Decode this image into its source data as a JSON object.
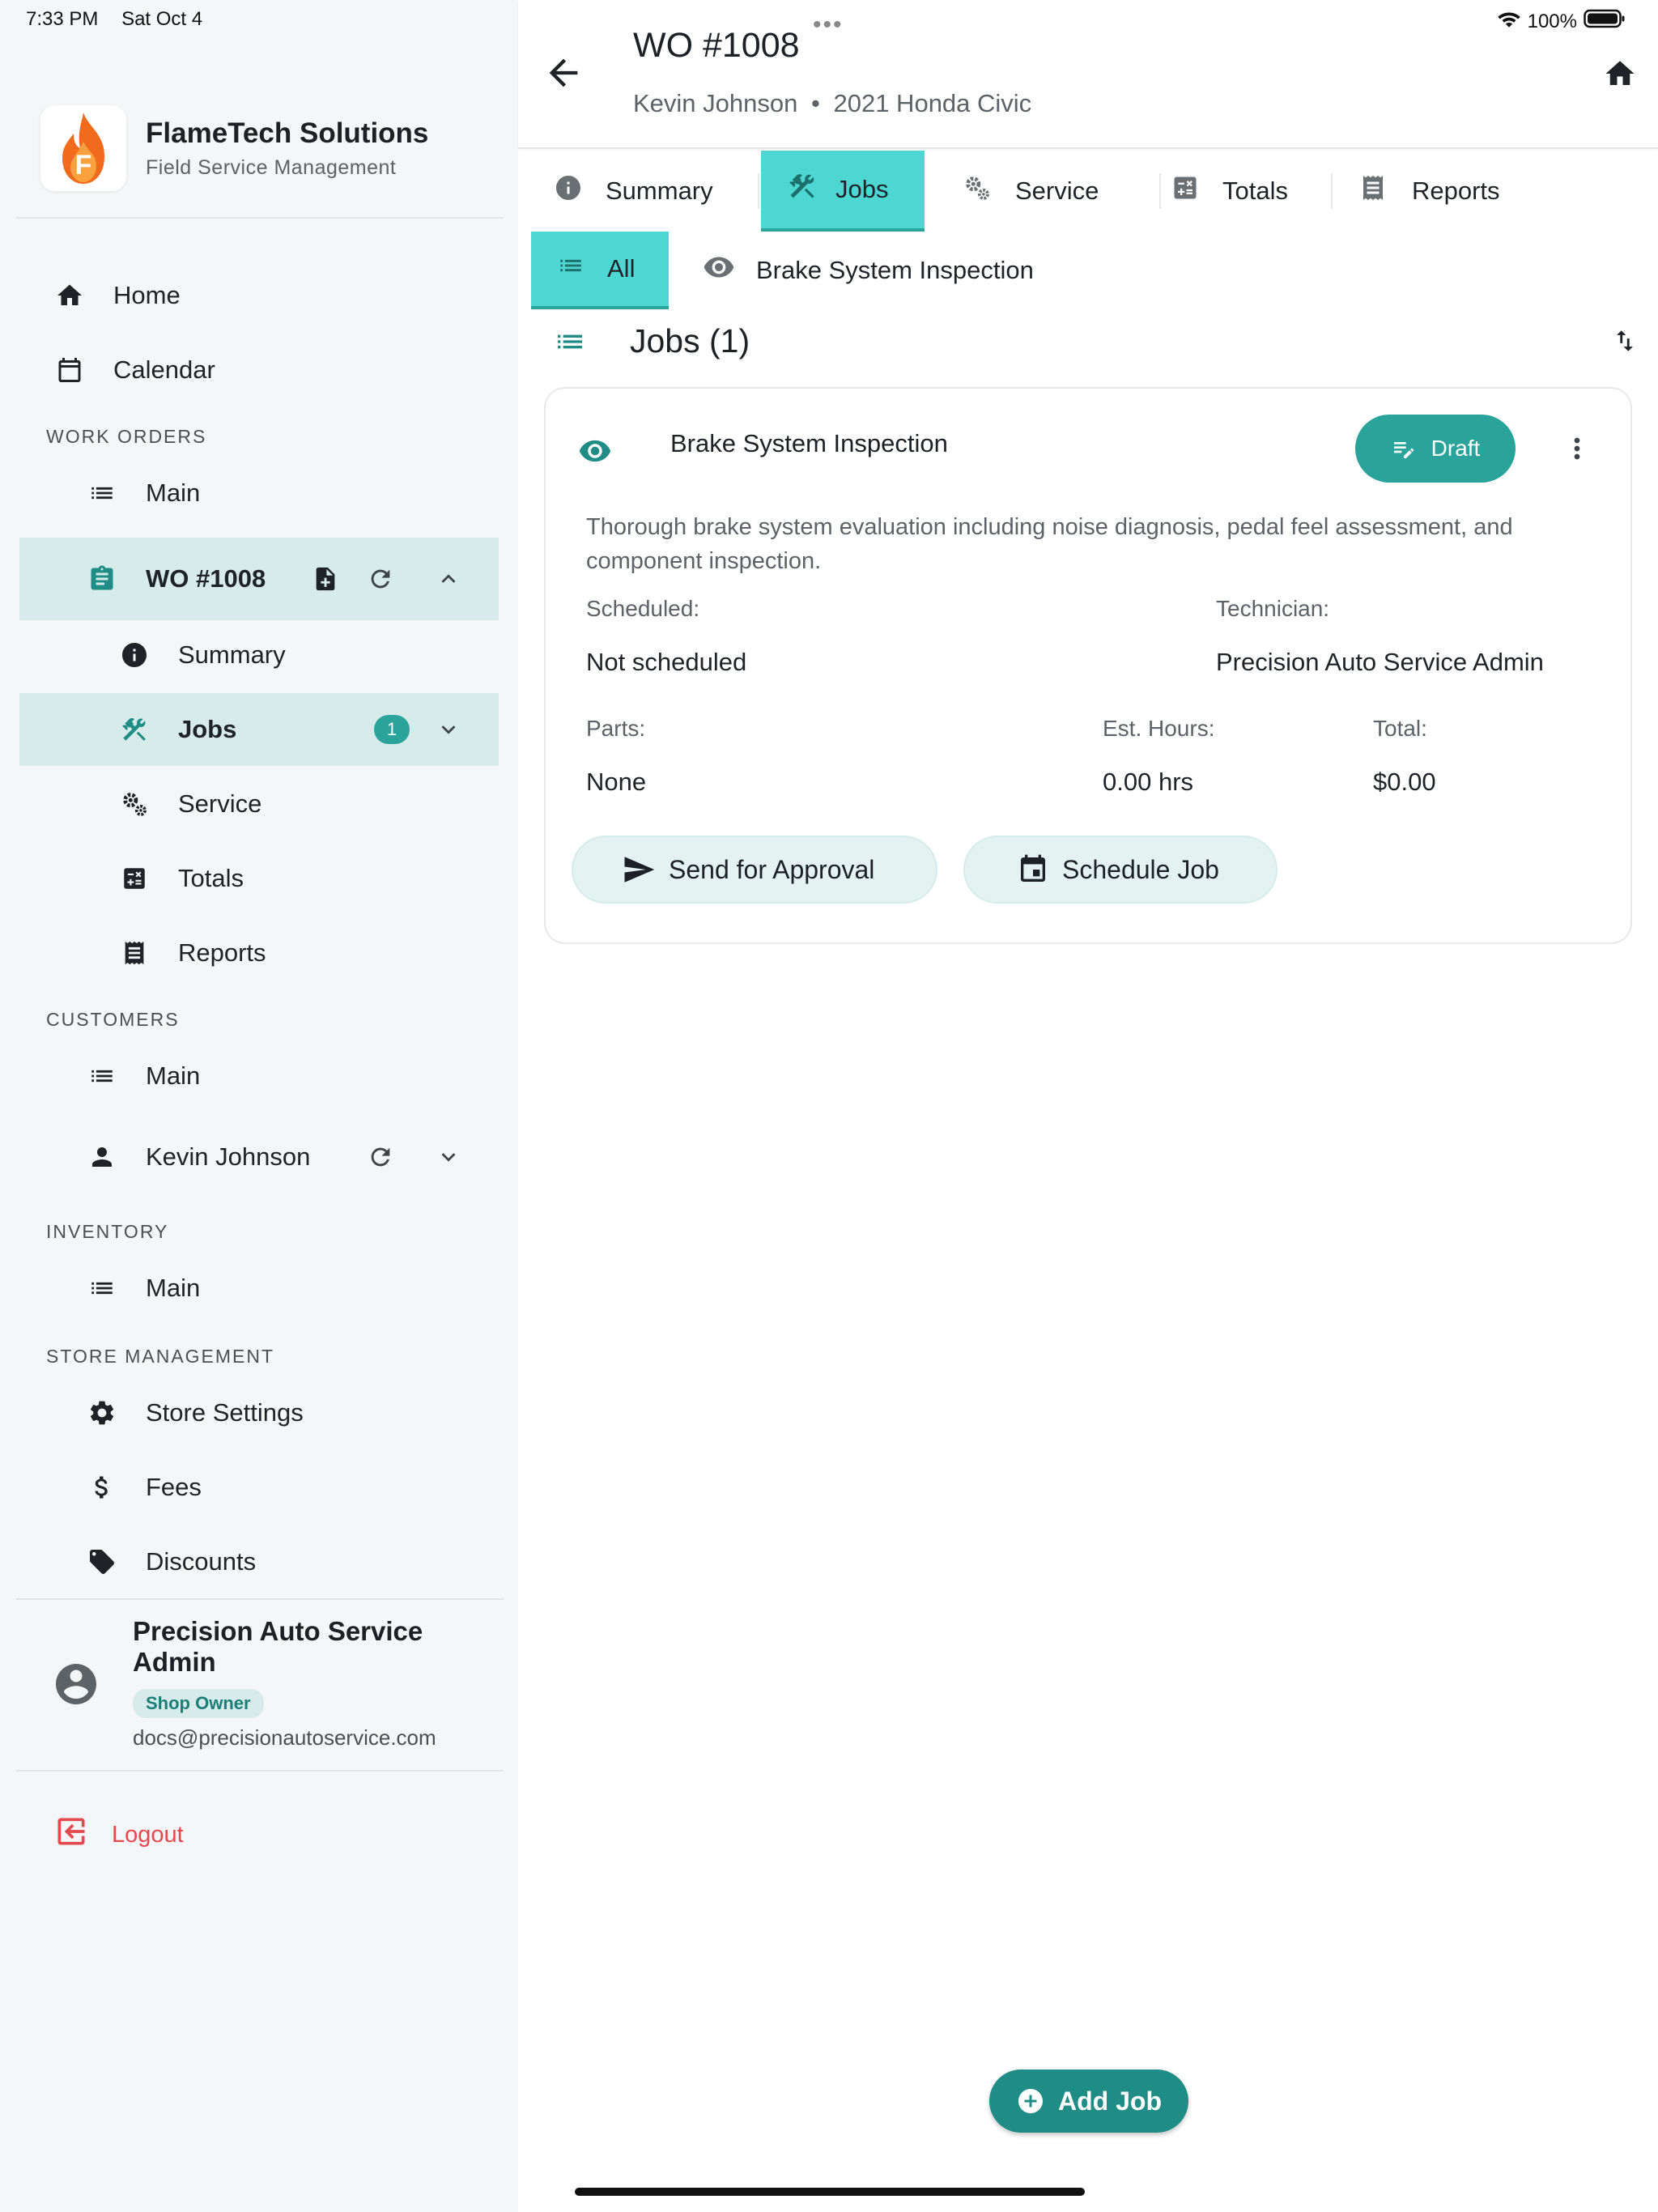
{
  "status_bar": {
    "time": "7:33 PM",
    "date": "Sat Oct 4",
    "battery": "100%"
  },
  "brand": {
    "name": "FlameTech Solutions",
    "subtitle": "Field Service Management",
    "logo_letter": "F"
  },
  "sidebar": {
    "home": "Home",
    "calendar": "Calendar",
    "sections": {
      "work_orders": "WORK ORDERS",
      "customers": "CUSTOMERS",
      "inventory": "INVENTORY",
      "store_management": "STORE MANAGEMENT"
    },
    "wo_main": "Main",
    "wo_current": "WO #1008",
    "wo_children": {
      "summary": "Summary",
      "jobs": "Jobs",
      "jobs_count": "1",
      "service": "Service",
      "totals": "Totals",
      "reports": "Reports"
    },
    "customers_main": "Main",
    "customer_current": "Kevin Johnson",
    "inventory_main": "Main",
    "store_settings": "Store Settings",
    "fees": "Fees",
    "discounts": "Discounts",
    "user": {
      "name": "Precision Auto Service Admin",
      "role": "Shop Owner",
      "email": "docs@precisionautoservice.com"
    },
    "logout": "Logout"
  },
  "header": {
    "title": "WO #1008",
    "customer": "Kevin Johnson",
    "separator": "•",
    "vehicle": "2021 Honda Civic"
  },
  "tabs": [
    "Summary",
    "Jobs",
    "Service",
    "Totals",
    "Reports"
  ],
  "subtabs": {
    "all": "All",
    "job": "Brake System Inspection"
  },
  "jobs_heading": "Jobs (1)",
  "job": {
    "name": "Brake System Inspection",
    "status": "Draft",
    "description": "Thorough brake system evaluation including noise diagnosis, pedal feel assessment, and component inspection.",
    "scheduled_label": "Scheduled:",
    "scheduled_value": "Not scheduled",
    "technician_label": "Technician:",
    "technician_value": "Precision Auto Service Admin",
    "parts_label": "Parts:",
    "parts_value": "None",
    "hours_label": "Est. Hours:",
    "hours_value": "0.00 hrs",
    "total_label": "Total:",
    "total_value": "$0.00",
    "send_approval": "Send for Approval",
    "schedule_job": "Schedule Job"
  },
  "fab_label": "Add Job",
  "colors": {
    "accent": "#2aa39a",
    "tab_selected": "#4dd6d2",
    "sidebar_selected": "#d7ebea",
    "logout": "#e5484d",
    "fab": "#1f8c86"
  }
}
